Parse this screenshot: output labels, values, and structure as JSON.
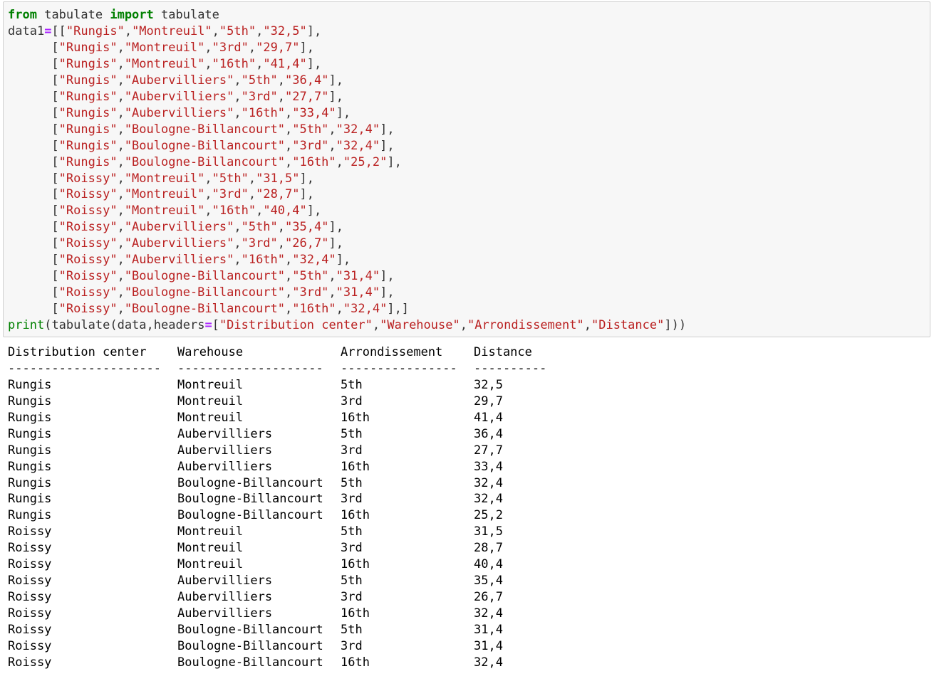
{
  "code": {
    "kw_from": "from",
    "module": "tabulate",
    "kw_import": "import",
    "imported": "tabulate",
    "var": "data1",
    "eq": "=",
    "rows": [
      [
        "Rungis",
        "Montreuil",
        "5th",
        "32,5"
      ],
      [
        "Rungis",
        "Montreuil",
        "3rd",
        "29,7"
      ],
      [
        "Rungis",
        "Montreuil",
        "16th",
        "41,4"
      ],
      [
        "Rungis",
        "Aubervilliers",
        "5th",
        "36,4"
      ],
      [
        "Rungis",
        "Aubervilliers",
        "3rd",
        "27,7"
      ],
      [
        "Rungis",
        "Aubervilliers",
        "16th",
        "33,4"
      ],
      [
        "Rungis",
        "Boulogne-Billancourt",
        "5th",
        "32,4"
      ],
      [
        "Rungis",
        "Boulogne-Billancourt",
        "3rd",
        "32,4"
      ],
      [
        "Rungis",
        "Boulogne-Billancourt",
        "16th",
        "25,2"
      ],
      [
        "Roissy",
        "Montreuil",
        "5th",
        "31,5"
      ],
      [
        "Roissy",
        "Montreuil",
        "3rd",
        "28,7"
      ],
      [
        "Roissy",
        "Montreuil",
        "16th",
        "40,4"
      ],
      [
        "Roissy",
        "Aubervilliers",
        "5th",
        "35,4"
      ],
      [
        "Roissy",
        "Aubervilliers",
        "3rd",
        "26,7"
      ],
      [
        "Roissy",
        "Aubervilliers",
        "16th",
        "32,4"
      ],
      [
        "Roissy",
        "Boulogne-Billancourt",
        "5th",
        "31,4"
      ],
      [
        "Roissy",
        "Boulogne-Billancourt",
        "3rd",
        "31,4"
      ],
      [
        "Roissy",
        "Boulogne-Billancourt",
        "16th",
        "32,4"
      ]
    ],
    "print_fn": "print",
    "call_fn": "tabulate",
    "arg_data": "data",
    "kwarg": "headers",
    "headers": [
      "Distribution center",
      "Warehouse",
      "Arrondissement",
      "Distance"
    ]
  },
  "output": {
    "headers": [
      "Distribution center",
      "Warehouse",
      "Arrondissement",
      "Distance"
    ],
    "separators": [
      "---------------------",
      "--------------------",
      "----------------",
      "----------"
    ],
    "rows": [
      [
        "Rungis",
        "Montreuil",
        "5th",
        "32,5"
      ],
      [
        "Rungis",
        "Montreuil",
        "3rd",
        "29,7"
      ],
      [
        "Rungis",
        "Montreuil",
        "16th",
        "41,4"
      ],
      [
        "Rungis",
        "Aubervilliers",
        "5th",
        "36,4"
      ],
      [
        "Rungis",
        "Aubervilliers",
        "3rd",
        "27,7"
      ],
      [
        "Rungis",
        "Aubervilliers",
        "16th",
        "33,4"
      ],
      [
        "Rungis",
        "Boulogne-Billancourt",
        "5th",
        "32,4"
      ],
      [
        "Rungis",
        "Boulogne-Billancourt",
        "3rd",
        "32,4"
      ],
      [
        "Rungis",
        "Boulogne-Billancourt",
        "16th",
        "25,2"
      ],
      [
        "Roissy",
        "Montreuil",
        "5th",
        "31,5"
      ],
      [
        "Roissy",
        "Montreuil",
        "3rd",
        "28,7"
      ],
      [
        "Roissy",
        "Montreuil",
        "16th",
        "40,4"
      ],
      [
        "Roissy",
        "Aubervilliers",
        "5th",
        "35,4"
      ],
      [
        "Roissy",
        "Aubervilliers",
        "3rd",
        "26,7"
      ],
      [
        "Roissy",
        "Aubervilliers",
        "16th",
        "32,4"
      ],
      [
        "Roissy",
        "Boulogne-Billancourt",
        "5th",
        "31,4"
      ],
      [
        "Roissy",
        "Boulogne-Billancourt",
        "3rd",
        "31,4"
      ],
      [
        "Roissy",
        "Boulogne-Billancourt",
        "16th",
        "32,4"
      ]
    ]
  },
  "colors": {
    "keyword": "#008000",
    "string": "#ba2121",
    "operator": "#aa22ff",
    "text": "#333333",
    "cell_background": "#f7f7f7",
    "cell_border": "#cfcfcf"
  }
}
